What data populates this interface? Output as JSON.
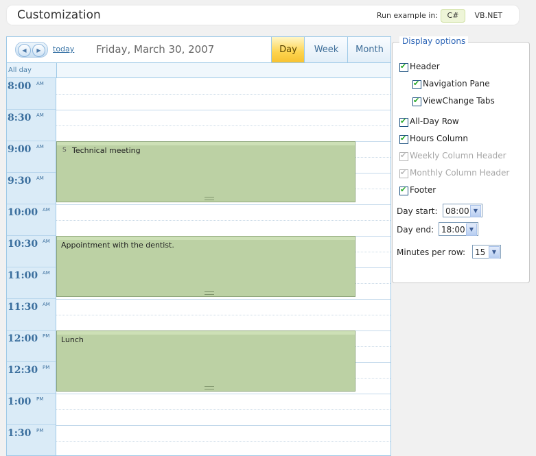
{
  "header": {
    "title": "Customization",
    "run_label": "Run example in:",
    "languages": [
      "C#",
      "VB.NET"
    ]
  },
  "scheduler": {
    "nav": {
      "prev_icon": "left-arrow-icon",
      "next_icon": "right-arrow-icon",
      "today": "today"
    },
    "date": "Friday, March 30, 2007",
    "tabs": [
      "Day",
      "Week",
      "Month"
    ],
    "active_tab": "Day",
    "allday_label": "All day",
    "hours": [
      {
        "time": "8:00",
        "ampm": "AM"
      },
      {
        "time": "8:30",
        "ampm": "AM"
      },
      {
        "time": "9:00",
        "ampm": "AM"
      },
      {
        "time": "9:30",
        "ampm": "AM"
      },
      {
        "time": "10:00",
        "ampm": "AM"
      },
      {
        "time": "10:30",
        "ampm": "AM"
      },
      {
        "time": "11:00",
        "ampm": "AM"
      },
      {
        "time": "11:30",
        "ampm": "AM"
      },
      {
        "time": "12:00",
        "ampm": "PM"
      },
      {
        "time": "12:30",
        "ampm": "PM"
      },
      {
        "time": "1:00",
        "ampm": "PM"
      },
      {
        "time": "1:30",
        "ampm": "PM"
      }
    ],
    "appointments": [
      {
        "subject": "Technical meeting",
        "recurring_glyph": "S"
      },
      {
        "subject": "Appointment with the dentist."
      },
      {
        "subject": "Lunch"
      }
    ]
  },
  "options": {
    "legend": "Display options",
    "checkboxes": {
      "header": "Header",
      "nav_pane": "Navigation Pane",
      "viewchange_tabs": "ViewChange Tabs",
      "allday_row": "All-Day Row",
      "hours_column": "Hours Column",
      "weekly_column_header": "Weekly Column Header",
      "monthly_column_header": "Monthly Column Header",
      "footer": "Footer"
    },
    "day_start_label": "Day start:",
    "day_start_value": "08:00",
    "day_end_label": "Day end:",
    "day_end_value": "18:00",
    "minutes_label": "Minutes per row:",
    "minutes_value": "15"
  },
  "colors": {
    "accent": "#2b64b6",
    "appointment": "#bcd1a4",
    "active_tab": "#fdd44e"
  }
}
